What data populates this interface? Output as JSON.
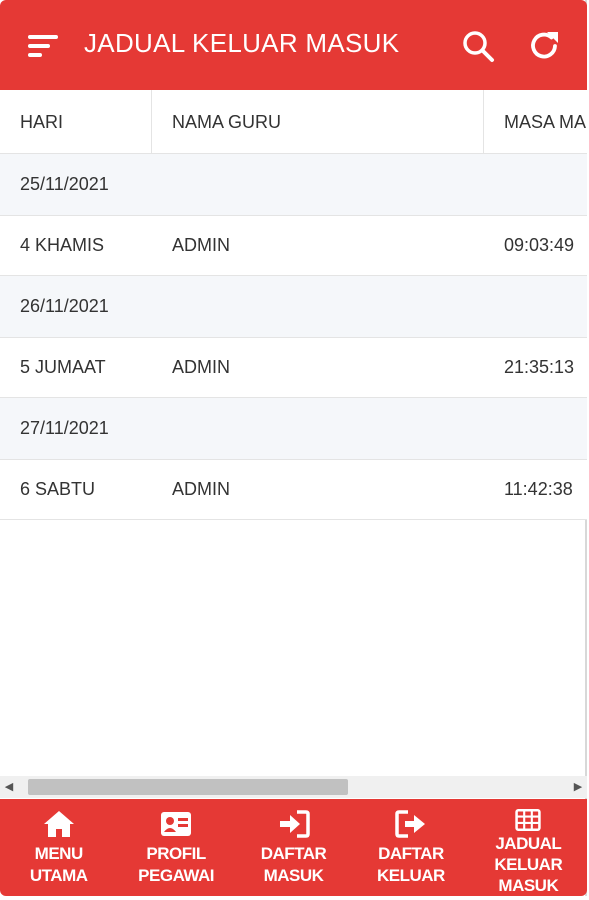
{
  "header": {
    "title": "JADUAL KELUAR MASUK",
    "menu_icon": "hamburger-menu-icon",
    "search_icon": "search-icon",
    "refresh_icon": "refresh-icon",
    "color": "#e53935"
  },
  "table": {
    "columns": [
      "HARI",
      "NAMA GURU",
      "MASA MA"
    ],
    "rows": [
      {
        "type": "group",
        "date": "25/11/2021"
      },
      {
        "type": "data",
        "hari": "4 KHAMIS",
        "nama": "ADMIN",
        "masa": "09:03:49"
      },
      {
        "type": "group",
        "date": "26/11/2021"
      },
      {
        "type": "data",
        "hari": "5 JUMAAT",
        "nama": "ADMIN",
        "masa": "21:35:13"
      },
      {
        "type": "group",
        "date": "27/11/2021"
      },
      {
        "type": "data",
        "hari": "6 SABTU",
        "nama": "ADMIN",
        "masa": "11:42:38"
      }
    ]
  },
  "bottom_nav": [
    {
      "line1": "MENU",
      "line2": "UTAMA",
      "line3": "",
      "icon": "home-icon"
    },
    {
      "line1": "PROFIL",
      "line2": "PEGAWAI",
      "line3": "",
      "icon": "id-card-icon"
    },
    {
      "line1": "DAFTAR",
      "line2": "MASUK",
      "line3": "",
      "icon": "sign-in-icon"
    },
    {
      "line1": "DAFTAR",
      "line2": "KELUAR",
      "line3": "",
      "icon": "sign-out-icon"
    },
    {
      "line1": "JADUAL",
      "line2": "KELUAR",
      "line3": "MASUK",
      "icon": "table-grid-icon",
      "active": true
    }
  ]
}
